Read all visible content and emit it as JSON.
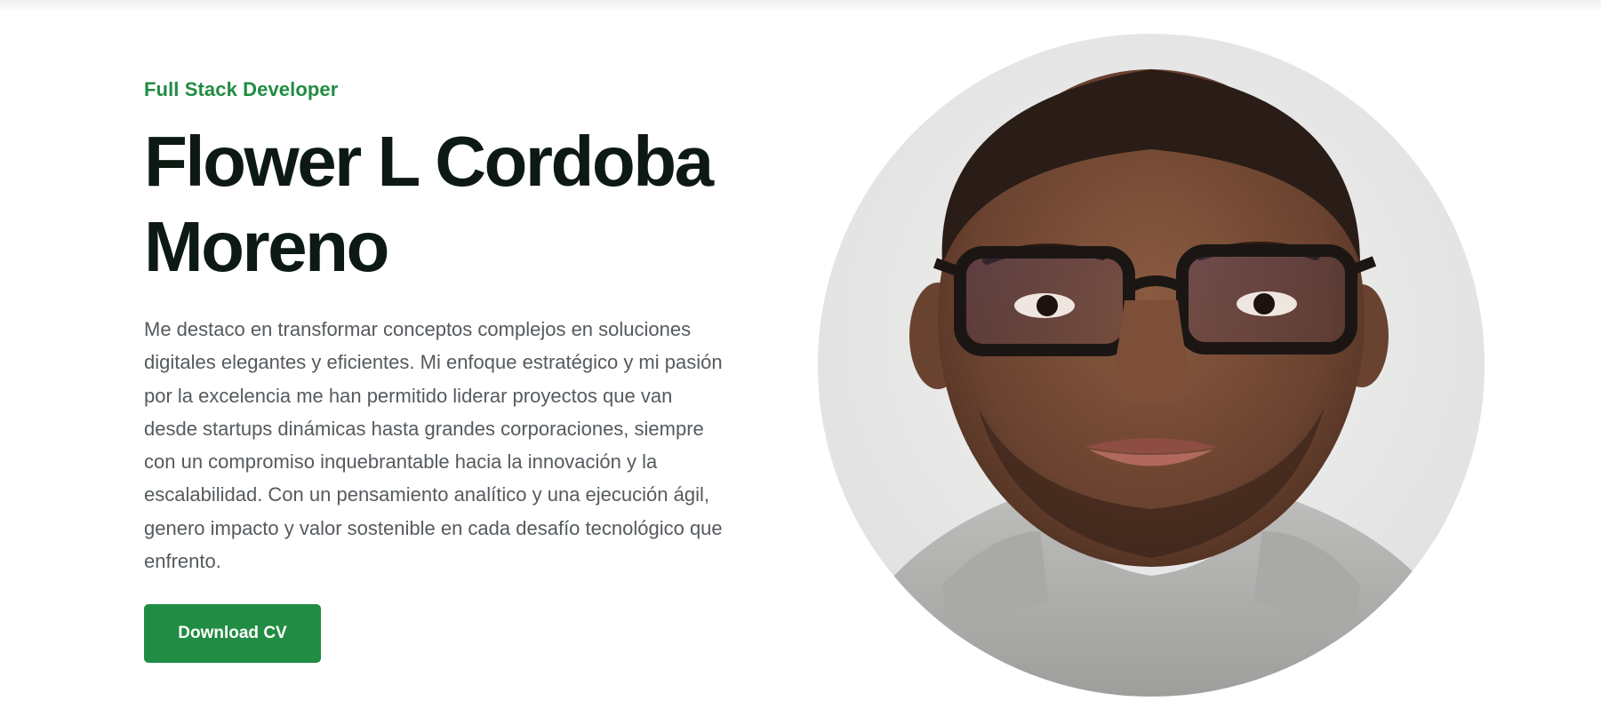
{
  "hero": {
    "role": "Full Stack Developer",
    "name": "Flower L Cordoba Moreno",
    "bio": "Me destaco en transformar conceptos complejos en soluciones digitales elegantes y eficientes. Mi enfoque estratégico y mi pasión por la excelencia me han permitido liderar proyectos que van desde startups dinámicas hasta grandes corporaciones, siempre con un compromiso inquebrantable hacia la innovación y la escalabilidad. Con un pensamiento analítico y una ejecución ágil, genero impacto y valor sostenible en cada desafío tecnológico que enfrento.",
    "download_label": "Download CV"
  },
  "colors": {
    "accent": "#218c43",
    "heading": "#0d1a13",
    "body_text": "#555a5e"
  }
}
